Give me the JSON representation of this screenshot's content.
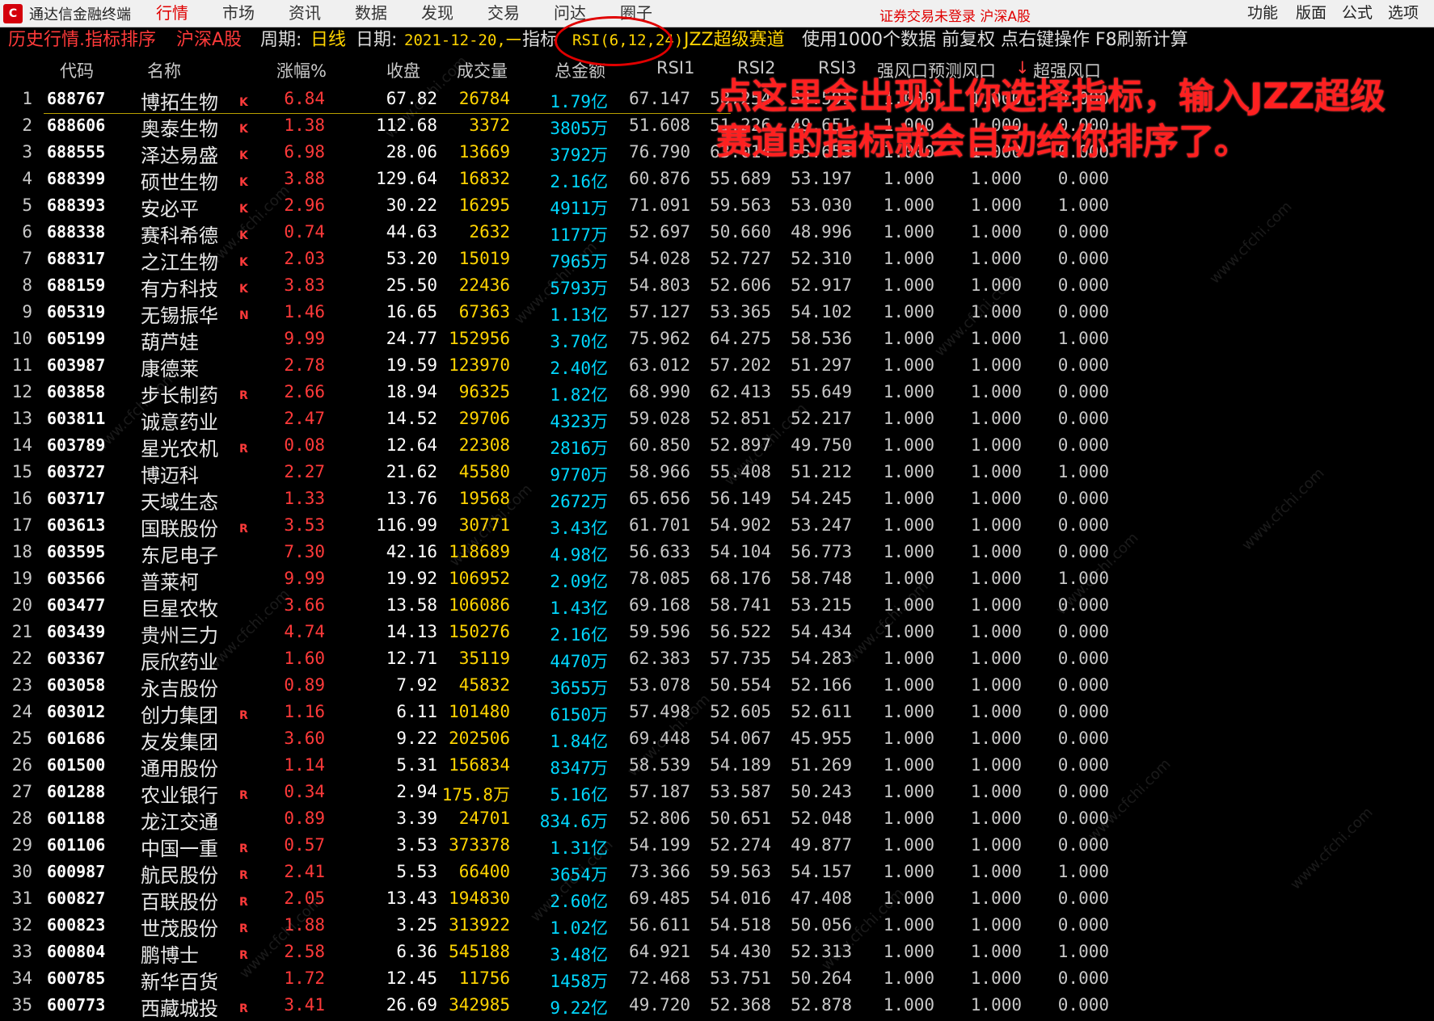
{
  "app": {
    "title": "通达信金融终端",
    "logo_char": "C"
  },
  "nav": [
    "行情",
    "市场",
    "资讯",
    "数据",
    "发现",
    "交易",
    "问达",
    "圈子"
  ],
  "status": "证券交易未登录  沪深A股",
  "right_menu": [
    "功能",
    "版面",
    "公式",
    "选项"
  ],
  "infobar": {
    "mode": "历史行情.指标排序",
    "market": "沪深A股",
    "period_label": "周期:",
    "period": "日线",
    "date_label": "日期:",
    "date": "2021-12-20,一",
    "indicator_label": "指标",
    "indicator": "RSI(6,12,24)",
    "formula": "JZZ超级赛道",
    "note": "使用1000个数据 前复权 点右键操作 F8刷新计算"
  },
  "headers": {
    "code": "代码",
    "name": "名称",
    "chg": "涨幅%",
    "close": "收盘",
    "vol": "成交量",
    "amt": "总金额",
    "rsi1": "RSI1",
    "rsi2": "RSI2",
    "rsi3": "RSI3",
    "f1": "强风口预测风口",
    "f2": "↓",
    "f3": "超强风口"
  },
  "annotation": "点这里会出现让你选择指标，输入JZZ超级赛道的指标就会自动给你排序了。",
  "watermark": "www.cfchi.com",
  "rows": [
    [
      "1",
      "688767",
      "博拓生物",
      "K",
      "6.84",
      "67.82",
      "26784",
      "1.79亿",
      "67.147",
      "58.254",
      "54.591",
      "1.000",
      "1.000",
      "0.000"
    ],
    [
      "2",
      "688606",
      "奥泰生物",
      "K",
      "1.38",
      "112.68",
      "3372",
      "3805万",
      "51.608",
      "51.226",
      "49.651",
      "1.000",
      "1.000",
      "0.000"
    ],
    [
      "3",
      "688555",
      "泽达易盛",
      "K",
      "6.98",
      "28.06",
      "13669",
      "3792万",
      "76.790",
      "63.014",
      "55.653",
      "1.000",
      "1.000",
      "0.000"
    ],
    [
      "4",
      "688399",
      "硕世生物",
      "K",
      "3.88",
      "129.64",
      "16832",
      "2.16亿",
      "60.876",
      "55.689",
      "53.197",
      "1.000",
      "1.000",
      "0.000"
    ],
    [
      "5",
      "688393",
      "安必平",
      "K",
      "2.96",
      "30.22",
      "16295",
      "4911万",
      "71.091",
      "59.563",
      "53.030",
      "1.000",
      "1.000",
      "1.000"
    ],
    [
      "6",
      "688338",
      "赛科希德",
      "K",
      "0.74",
      "44.63",
      "2632",
      "1177万",
      "52.697",
      "50.660",
      "48.996",
      "1.000",
      "1.000",
      "0.000"
    ],
    [
      "7",
      "688317",
      "之江生物",
      "K",
      "2.03",
      "53.20",
      "15019",
      "7965万",
      "54.028",
      "52.727",
      "52.310",
      "1.000",
      "1.000",
      "0.000"
    ],
    [
      "8",
      "688159",
      "有方科技",
      "K",
      "3.83",
      "25.50",
      "22436",
      "5793万",
      "54.803",
      "52.606",
      "52.917",
      "1.000",
      "1.000",
      "0.000"
    ],
    [
      "9",
      "605319",
      "无锡振华",
      "N",
      "1.46",
      "16.65",
      "67363",
      "1.13亿",
      "57.127",
      "53.365",
      "54.102",
      "1.000",
      "1.000",
      "0.000"
    ],
    [
      "10",
      "605199",
      "葫芦娃",
      "",
      "9.99",
      "24.77",
      "152956",
      "3.70亿",
      "75.962",
      "64.275",
      "58.536",
      "1.000",
      "1.000",
      "1.000"
    ],
    [
      "11",
      "603987",
      "康德莱",
      "",
      "2.78",
      "19.59",
      "123970",
      "2.40亿",
      "63.012",
      "57.202",
      "51.297",
      "1.000",
      "1.000",
      "0.000"
    ],
    [
      "12",
      "603858",
      "步长制药",
      "R",
      "2.66",
      "18.94",
      "96325",
      "1.82亿",
      "68.990",
      "62.413",
      "55.649",
      "1.000",
      "1.000",
      "0.000"
    ],
    [
      "13",
      "603811",
      "诚意药业",
      "",
      "2.47",
      "14.52",
      "29706",
      "4323万",
      "59.028",
      "52.851",
      "52.217",
      "1.000",
      "1.000",
      "0.000"
    ],
    [
      "14",
      "603789",
      "星光农机",
      "R",
      "0.08",
      "12.64",
      "22308",
      "2816万",
      "60.850",
      "52.897",
      "49.750",
      "1.000",
      "1.000",
      "0.000"
    ],
    [
      "15",
      "603727",
      "博迈科",
      "",
      "2.27",
      "21.62",
      "45580",
      "9770万",
      "58.966",
      "55.408",
      "51.212",
      "1.000",
      "1.000",
      "1.000"
    ],
    [
      "16",
      "603717",
      "天域生态",
      "",
      "1.33",
      "13.76",
      "19568",
      "2672万",
      "65.656",
      "56.149",
      "54.245",
      "1.000",
      "1.000",
      "0.000"
    ],
    [
      "17",
      "603613",
      "国联股份",
      "R",
      "3.53",
      "116.99",
      "30771",
      "3.43亿",
      "61.701",
      "54.902",
      "53.247",
      "1.000",
      "1.000",
      "0.000"
    ],
    [
      "18",
      "603595",
      "东尼电子",
      "",
      "7.30",
      "42.16",
      "118689",
      "4.98亿",
      "56.633",
      "54.104",
      "56.773",
      "1.000",
      "1.000",
      "0.000"
    ],
    [
      "19",
      "603566",
      "普莱柯",
      "",
      "9.99",
      "19.92",
      "106952",
      "2.09亿",
      "78.085",
      "68.176",
      "58.748",
      "1.000",
      "1.000",
      "1.000"
    ],
    [
      "20",
      "603477",
      "巨星农牧",
      "",
      "3.66",
      "13.58",
      "106086",
      "1.43亿",
      "69.168",
      "58.741",
      "53.215",
      "1.000",
      "1.000",
      "0.000"
    ],
    [
      "21",
      "603439",
      "贵州三力",
      "",
      "4.74",
      "14.13",
      "150276",
      "2.16亿",
      "59.596",
      "56.522",
      "54.434",
      "1.000",
      "1.000",
      "0.000"
    ],
    [
      "22",
      "603367",
      "辰欣药业",
      "",
      "1.60",
      "12.71",
      "35119",
      "4470万",
      "62.383",
      "57.735",
      "54.283",
      "1.000",
      "1.000",
      "0.000"
    ],
    [
      "23",
      "603058",
      "永吉股份",
      "",
      "0.89",
      "7.92",
      "45832",
      "3655万",
      "53.078",
      "50.554",
      "52.166",
      "1.000",
      "1.000",
      "0.000"
    ],
    [
      "24",
      "603012",
      "创力集团",
      "R",
      "1.16",
      "6.11",
      "101480",
      "6150万",
      "57.498",
      "52.605",
      "52.611",
      "1.000",
      "1.000",
      "0.000"
    ],
    [
      "25",
      "601686",
      "友发集团",
      "",
      "3.60",
      "9.22",
      "202506",
      "1.84亿",
      "69.448",
      "54.067",
      "45.955",
      "1.000",
      "1.000",
      "0.000"
    ],
    [
      "26",
      "601500",
      "通用股份",
      "",
      "1.14",
      "5.31",
      "156834",
      "8347万",
      "58.539",
      "54.189",
      "51.269",
      "1.000",
      "1.000",
      "0.000"
    ],
    [
      "27",
      "601288",
      "农业银行",
      "R",
      "0.34",
      "2.94",
      "175.8万",
      "5.16亿",
      "57.187",
      "53.587",
      "50.243",
      "1.000",
      "1.000",
      "0.000"
    ],
    [
      "28",
      "601188",
      "龙江交通",
      "",
      "0.89",
      "3.39",
      "24701",
      "834.6万",
      "52.806",
      "50.651",
      "52.048",
      "1.000",
      "1.000",
      "0.000"
    ],
    [
      "29",
      "601106",
      "中国一重",
      "R",
      "0.57",
      "3.53",
      "373378",
      "1.31亿",
      "54.199",
      "52.274",
      "49.877",
      "1.000",
      "1.000",
      "0.000"
    ],
    [
      "30",
      "600987",
      "航民股份",
      "R",
      "2.41",
      "5.53",
      "66400",
      "3654万",
      "73.366",
      "59.563",
      "54.157",
      "1.000",
      "1.000",
      "1.000"
    ],
    [
      "31",
      "600827",
      "百联股份",
      "R",
      "2.05",
      "13.43",
      "194830",
      "2.60亿",
      "69.485",
      "54.016",
      "47.408",
      "1.000",
      "1.000",
      "0.000"
    ],
    [
      "32",
      "600823",
      "世茂股份",
      "R",
      "1.88",
      "3.25",
      "313922",
      "1.02亿",
      "56.611",
      "54.518",
      "50.056",
      "1.000",
      "1.000",
      "0.000"
    ],
    [
      "33",
      "600804",
      "鹏博士",
      "R",
      "2.58",
      "6.36",
      "545188",
      "3.48亿",
      "64.921",
      "54.430",
      "52.313",
      "1.000",
      "1.000",
      "1.000"
    ],
    [
      "34",
      "600785",
      "新华百货",
      "",
      "1.72",
      "12.45",
      "11756",
      "1458万",
      "72.468",
      "53.751",
      "50.264",
      "1.000",
      "1.000",
      "0.000"
    ],
    [
      "35",
      "600773",
      "西藏城投",
      "R",
      "3.41",
      "26.69",
      "342985",
      "9.22亿",
      "49.720",
      "52.368",
      "52.878",
      "1.000",
      "1.000",
      "0.000"
    ]
  ]
}
